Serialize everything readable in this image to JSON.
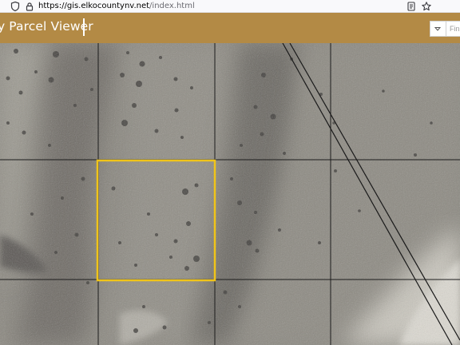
{
  "browser": {
    "url_host": "https://gis.elkocountynv.net",
    "url_path": "/index.html",
    "icons": [
      "shield-icon",
      "lock-icon",
      "reader-view-icon",
      "bookmark-star-icon"
    ]
  },
  "header": {
    "title": "y Parcel Viewer",
    "background_color": "#b38a45",
    "search": {
      "placeholder": "Fin",
      "dropdown_icon": "chevron-down-icon"
    }
  },
  "map": {
    "type": "aerial-imagery",
    "selected_parcel_color": "#f0c419",
    "parcel_line_color": "#1c1c1c",
    "features": [
      "parcel-grid",
      "selected-parcel",
      "road"
    ]
  }
}
